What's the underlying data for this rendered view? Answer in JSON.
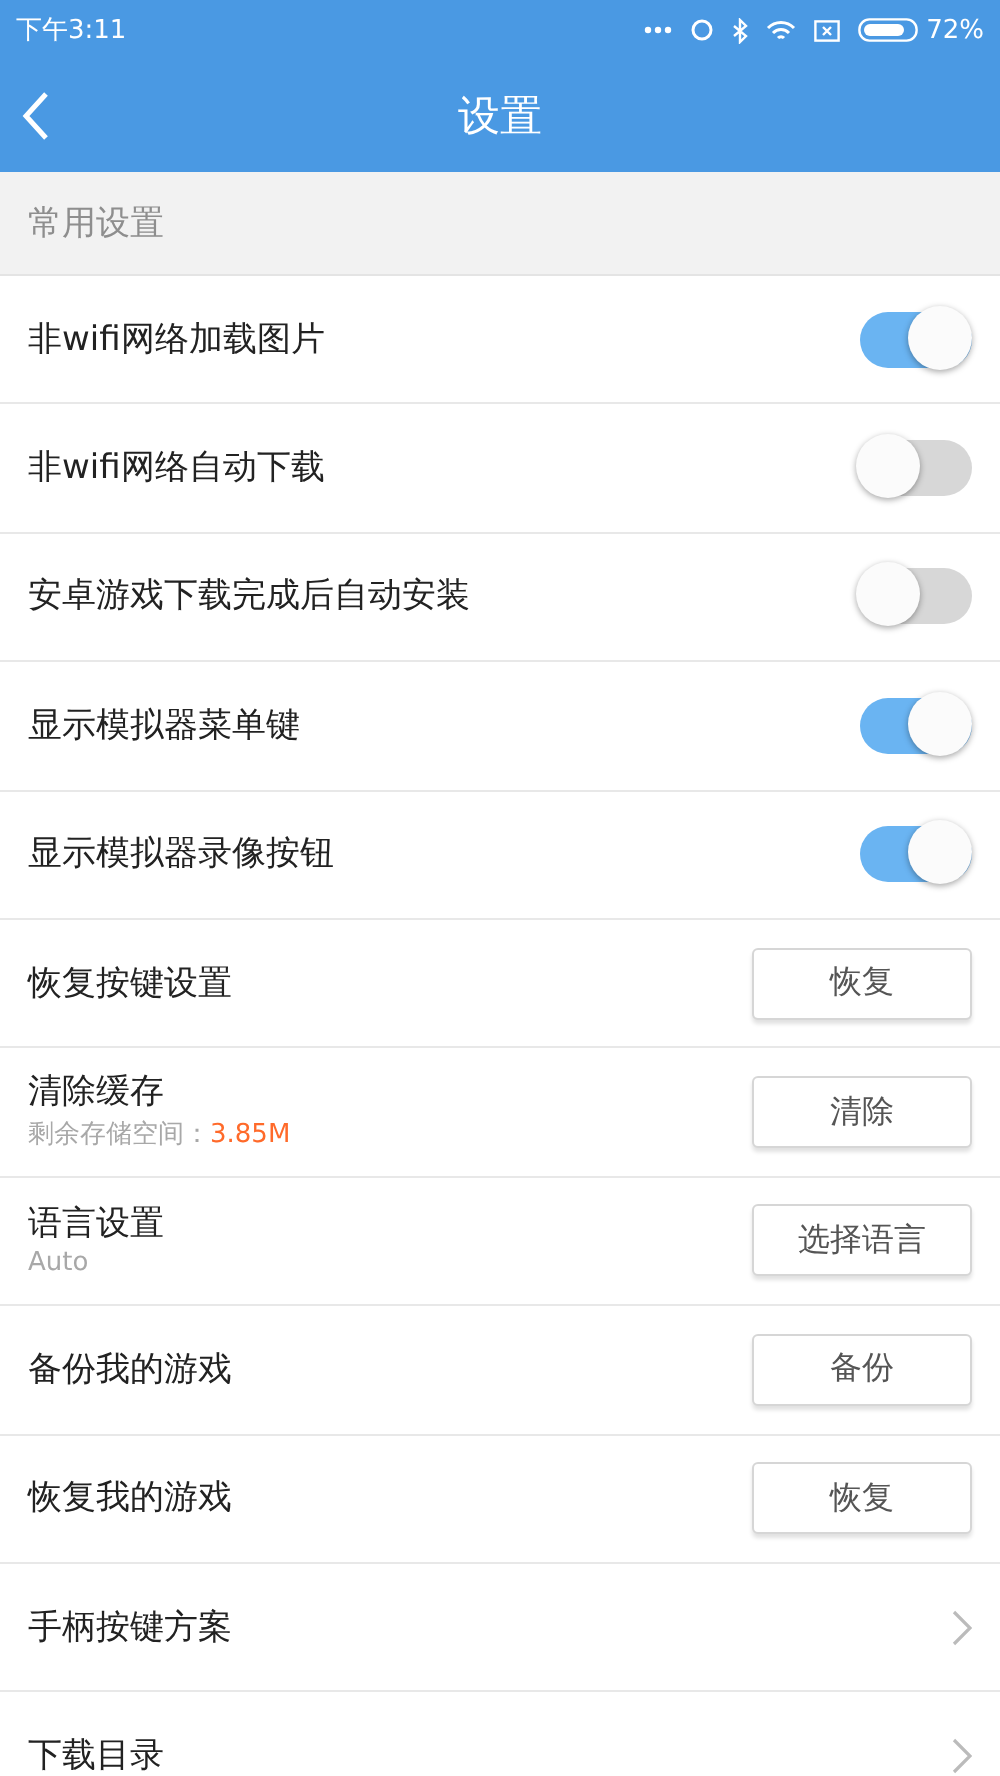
{
  "status_bar": {
    "time": "下午3:11",
    "battery": "72%"
  },
  "header": {
    "title": "设置"
  },
  "section": {
    "title": "常用设置"
  },
  "rows": [
    {
      "kind": "toggle",
      "label": "非wifi网络加载图片",
      "on": true
    },
    {
      "kind": "toggle",
      "label": "非wifi网络自动下载",
      "on": false
    },
    {
      "kind": "toggle",
      "label": "安卓游戏下载完成后自动安装",
      "on": false
    },
    {
      "kind": "toggle",
      "label": "显示模拟器菜单键",
      "on": true
    },
    {
      "kind": "toggle",
      "label": "显示模拟器录像按钮",
      "on": true
    },
    {
      "kind": "button",
      "label": "恢复按键设置",
      "button": "恢复"
    },
    {
      "kind": "button",
      "label": "清除缓存",
      "subtitle": "剩余存储空间：",
      "subtitle_value": "3.85M",
      "button": "清除"
    },
    {
      "kind": "button",
      "label": "语言设置",
      "subtitle": "Auto",
      "button": "选择语言"
    },
    {
      "kind": "button",
      "label": "备份我的游戏",
      "button": "备份"
    },
    {
      "kind": "button",
      "label": "恢复我的游戏",
      "button": "恢复"
    },
    {
      "kind": "link",
      "label": "手柄按键方案"
    },
    {
      "kind": "link",
      "label": "下载目录"
    }
  ]
}
